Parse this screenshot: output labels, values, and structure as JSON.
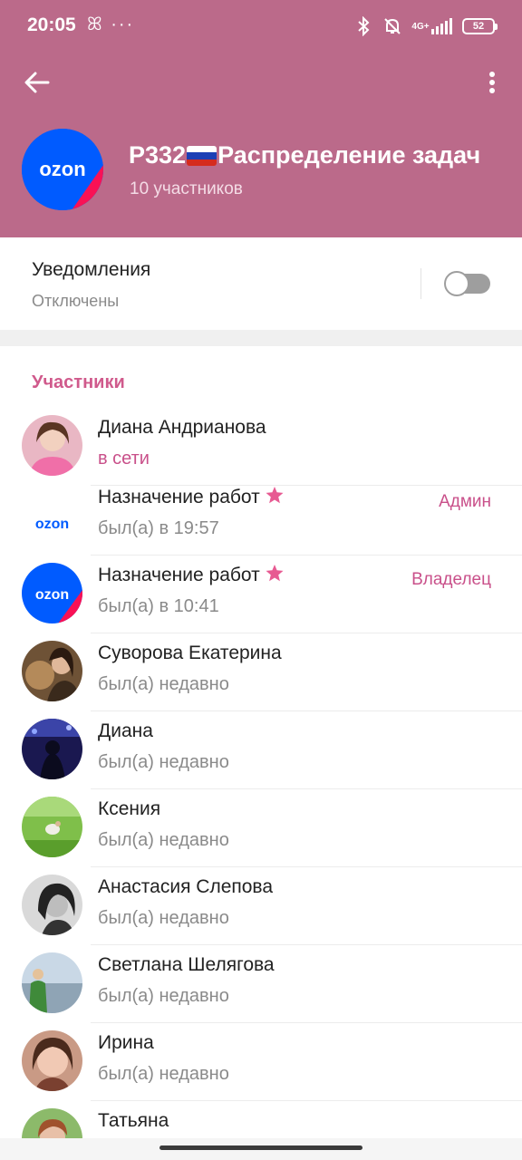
{
  "status_bar": {
    "time": "20:05",
    "left_icons": "ꕤ ···",
    "network_label": "4G+",
    "battery": "52"
  },
  "header": {
    "group_title_prefix": "Р332",
    "group_title_suffix": "Распределение задач",
    "members_count": "10 участников",
    "avatar_logo": "ozon"
  },
  "notifications": {
    "title": "Уведомления",
    "state": "Отключены",
    "enabled": false
  },
  "members_section": {
    "title": "Участники"
  },
  "members": [
    {
      "name": "Диана Андрианова",
      "status": "в сети",
      "online": true,
      "role": "",
      "star": false,
      "avatar": "photo-woman-pink"
    },
    {
      "name": "Назначение работ",
      "status": "был(а) в 19:57",
      "online": false,
      "role": "Админ",
      "star": true,
      "avatar": "ozon-logo-white"
    },
    {
      "name": "Назначение работ",
      "status": "был(а) в 10:41",
      "online": false,
      "role": "Владелец",
      "star": true,
      "avatar": "ozon-logo-blue"
    },
    {
      "name": "Суворова Екатерина",
      "status": "был(а) недавно",
      "online": false,
      "role": "",
      "star": false,
      "avatar": "photo-woman-lynx"
    },
    {
      "name": "Диана",
      "status": "был(а) недавно",
      "online": false,
      "role": "",
      "star": false,
      "avatar": "photo-night-city"
    },
    {
      "name": "Ксения",
      "status": "был(а) недавно",
      "online": false,
      "role": "",
      "star": false,
      "avatar": "photo-grass"
    },
    {
      "name": "Анастасия Слепова",
      "status": "был(а) недавно",
      "online": false,
      "role": "",
      "star": false,
      "avatar": "photo-bw-woman"
    },
    {
      "name": "Светлана Шелягова",
      "status": "был(а) недавно",
      "online": false,
      "role": "",
      "star": false,
      "avatar": "photo-seaside"
    },
    {
      "name": "Ирина",
      "status": "был(а) недавно",
      "online": false,
      "role": "",
      "star": false,
      "avatar": "photo-woman-dark-hair"
    },
    {
      "name": "Татьяна",
      "status": "",
      "online": false,
      "role": "",
      "star": false,
      "avatar": "photo-woman-garden"
    }
  ],
  "colors": {
    "header_bg": "#bb6a8a",
    "accent": "#c9508a",
    "ozon_blue": "#005bff",
    "ozon_pink": "#f91155"
  }
}
